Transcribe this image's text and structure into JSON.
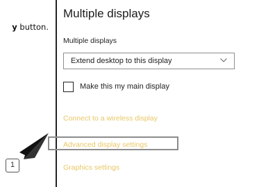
{
  "instruction": {
    "bold_text": "y",
    "text": " button."
  },
  "settings": {
    "title": "Multiple displays",
    "section_label": "Multiple displays",
    "dropdown": {
      "selected": "Extend desktop to this display"
    },
    "checkbox": {
      "label": "Make this my main display",
      "checked": false
    },
    "links": [
      {
        "label": "Connect to a wireless display"
      },
      {
        "label": "Advanced display settings"
      },
      {
        "label": "Graphics settings"
      }
    ],
    "link_color": "#e8c766"
  },
  "annotation": {
    "callout_number": "1",
    "highlight_target": "Advanced display settings"
  }
}
